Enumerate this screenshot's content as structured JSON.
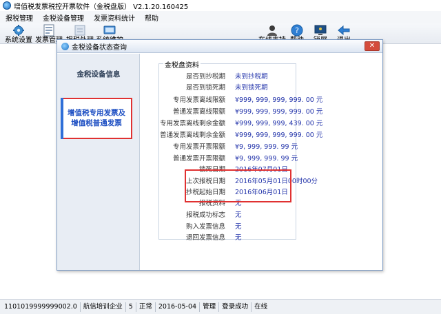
{
  "window": {
    "title": "增值税发票税控开票软件（金税盘版） V2.1.20.160425"
  },
  "menu": [
    "报税管理",
    "金税设备管理",
    "发票资料统计",
    "帮助"
  ],
  "toolbar": {
    "left": [
      "系统设置",
      "发票管理",
      "报税处理",
      "系统维护"
    ],
    "right": [
      "在线支持",
      "帮助",
      "锁屏",
      "退出"
    ]
  },
  "dialog": {
    "title": "金税设备状态查询",
    "nav": {
      "device_info": "金税设备信息",
      "vat_invoice": "增值税专用发票及增值税普通发票"
    },
    "group_title": "金税盘资料",
    "rows": [
      {
        "label": "是否到抄税期",
        "value": "未到抄税期"
      },
      {
        "label": "是否到锁死期",
        "value": "未到锁死期"
      },
      {
        "label": "专用发票离线限额",
        "value": "¥999, 999, 999, 999. 00 元"
      },
      {
        "label": "普通发票离线限额",
        "value": "¥999, 999, 999, 999. 00 元"
      },
      {
        "label": "专用发票离线剩余金额",
        "value": "¥999, 999, 999, 439. 00 元"
      },
      {
        "label": "普通发票离线剩余金额",
        "value": "¥999, 999, 999, 999. 00 元"
      },
      {
        "label": "专用发票开票限额",
        "value": "¥9, 999, 999. 99 元"
      },
      {
        "label": "普通发票开票限额",
        "value": "¥9, 999, 999. 99 元"
      },
      {
        "label": "锁死日期",
        "value": "2016年07月01日"
      },
      {
        "label": "上次报税日期",
        "value": "2016年05月01日00时00分"
      },
      {
        "label": "抄税起始日期",
        "value": "2016年06月01日"
      },
      {
        "label": "报税资料",
        "value": "无"
      },
      {
        "label": "报税成功标志",
        "value": "无"
      },
      {
        "label": "购入发票信息",
        "value": "无"
      },
      {
        "label": "退回发票信息",
        "value": "无"
      }
    ]
  },
  "status": [
    "1101019999999002.0",
    "航信培训企业",
    "5",
    "正常",
    "2016-05-04",
    "管理",
    "登录成功",
    "在线"
  ],
  "colors": {
    "highlight": "#e03131",
    "value_text": "#2233aa",
    "nav_active": "#1b4dc2"
  }
}
